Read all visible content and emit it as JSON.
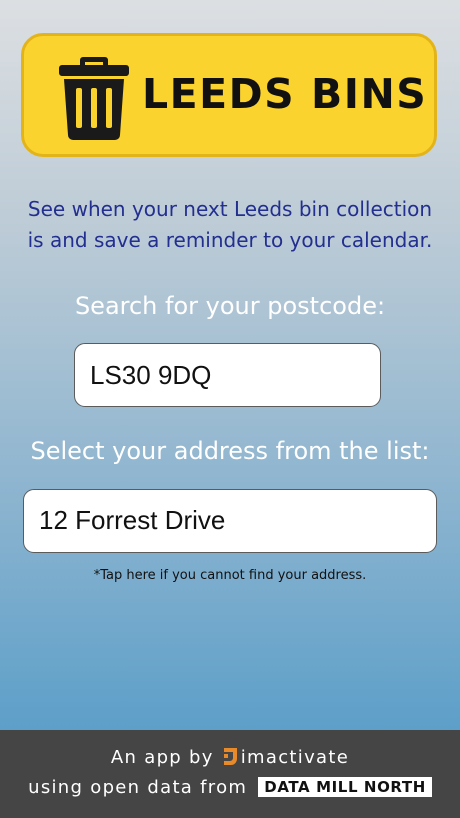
{
  "header": {
    "title": "LEEDS BINS",
    "logo_icon": "trash-bin-icon",
    "background_color": "#fbd32f"
  },
  "intro": {
    "text": "See when your next Leeds bin collection is and save a reminder to your calendar."
  },
  "postcode": {
    "label": "Search for your postcode:",
    "value": "LS30 9DQ"
  },
  "address": {
    "label": "Select your address from the list:",
    "value": "12 Forrest Drive"
  },
  "hint": {
    "text": "*Tap here if you cannot find your address."
  },
  "footer": {
    "line1_prefix": "An app by",
    "brand_name": "imactivate",
    "brand_icon": "imactivate-logo-icon",
    "line2_prefix": "using open data from",
    "data_partner": "DATA MILL NORTH",
    "brand_color": "#e8892a"
  }
}
